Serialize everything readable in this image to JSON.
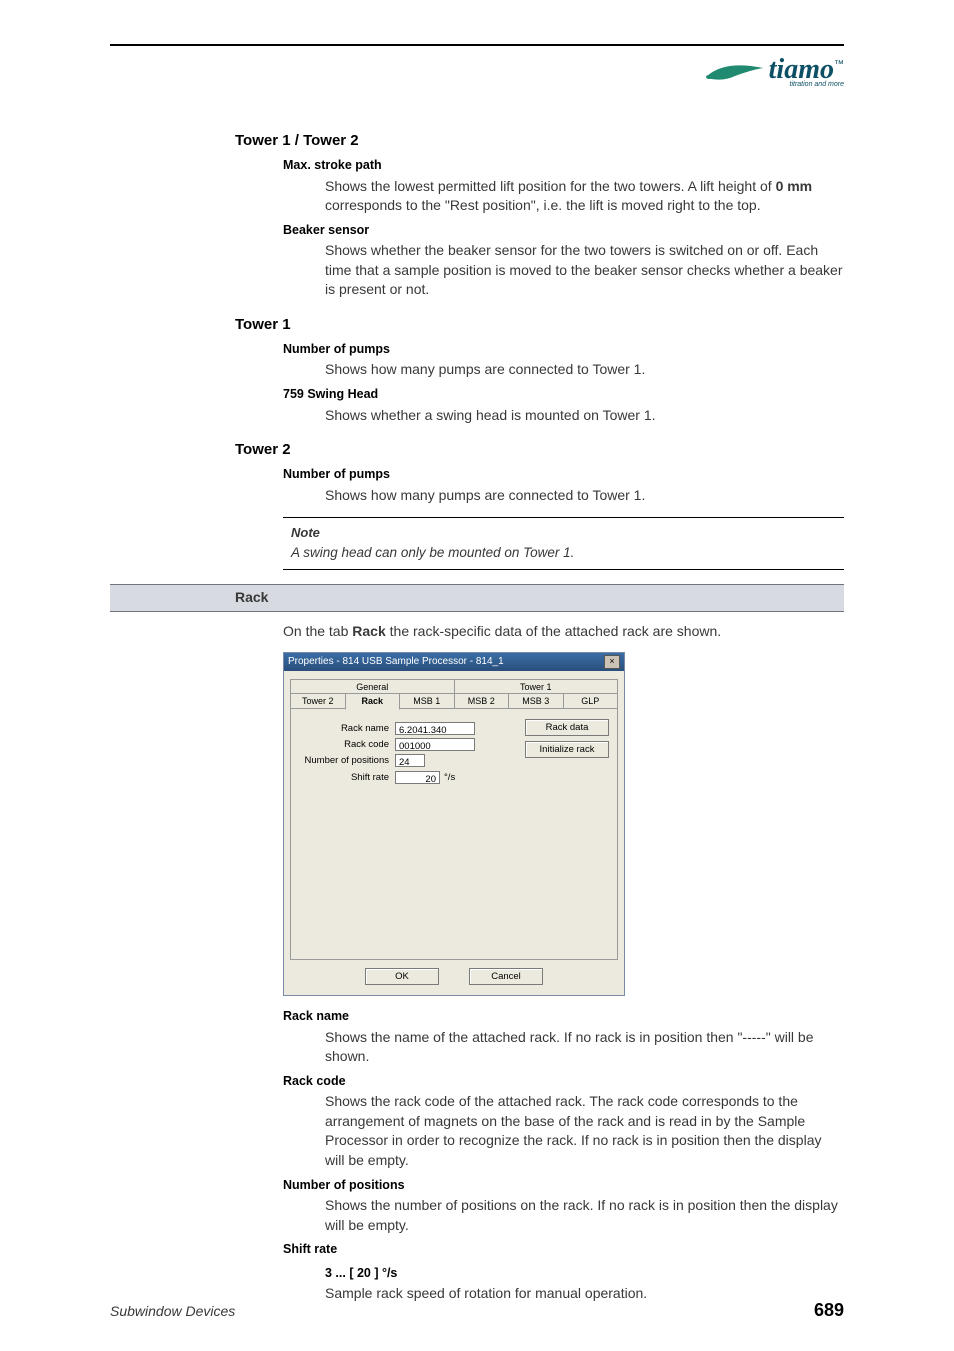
{
  "logo": {
    "brand": "tiamo",
    "tm": "™",
    "tag": "titration and more"
  },
  "s1": {
    "heading": "Tower 1 / Tower 2",
    "i1_label": "Max. stroke path",
    "i1_body_a": "Shows the lowest permitted lift position for the two towers. A lift height of ",
    "i1_body_b": "0 mm",
    "i1_body_c": " corresponds to the \"Rest position\", i.e. the lift is moved right to the top.",
    "i2_label": "Beaker sensor",
    "i2_body": "Shows whether the beaker sensor for the two towers is switched on or off. Each time that a sample position is moved to the beaker sensor checks whether a beaker is present or not."
  },
  "s2": {
    "heading": "Tower 1",
    "i1_label": "Number of pumps",
    "i1_body": "Shows how many pumps are connected to Tower 1.",
    "i2_label": "759 Swing Head",
    "i2_body": "Shows whether a swing head is mounted on Tower 1."
  },
  "s3": {
    "heading": "Tower 2",
    "i1_label": "Number of pumps",
    "i1_body": "Shows how many pumps are connected to Tower 1."
  },
  "note": {
    "title": "Note",
    "body": "A swing head can only be mounted on Tower 1."
  },
  "band": "Rack",
  "intro_a": "On the tab ",
  "intro_b": "Rack",
  "intro_c": " the rack-specific data of the attached rack are shown.",
  "dlg": {
    "title": "Properties - 814 USB Sample Processor - 814_1",
    "tabs_top": {
      "general": "General",
      "tower1": "Tower 1"
    },
    "tabs_bot": {
      "tower2": "Tower 2",
      "rack": "Rack",
      "msb1": "MSB 1",
      "msb2": "MSB 2",
      "msb3": "MSB 3",
      "glp": "GLP"
    },
    "rack_name_label": "Rack name",
    "rack_name_value": "6.2041.340",
    "rack_code_label": "Rack code",
    "rack_code_value": "001000",
    "numpos_label": "Number of positions",
    "numpos_value": "24",
    "shift_label": "Shift rate",
    "shift_value": "20",
    "shift_unit": "°/s",
    "btn_rackdata": "Rack data",
    "btn_init": "Initialize rack",
    "ok": "OK",
    "cancel": "Cancel"
  },
  "s4": {
    "i1_label": "Rack name",
    "i1_body": "Shows the name of the attached rack. If no rack is in position then \"-----\" will be shown.",
    "i2_label": "Rack code",
    "i2_body": "Shows the rack code of the attached rack. The rack code corresponds to the arrangement of magnets on the base of the rack and is read in by the Sample Processor in order to recognize the rack. If no rack is in position then the display will be empty.",
    "i3_label": "Number of positions",
    "i3_body": "Shows the number of positions on the rack. If no rack is in position then the display will be empty.",
    "i4_label": "Shift rate",
    "i4_sub": "3 ... [ 20 ] °/s",
    "i4_body": "Sample rack speed of rotation for manual operation."
  },
  "footer": {
    "left": "Subwindow Devices",
    "right": "689"
  }
}
